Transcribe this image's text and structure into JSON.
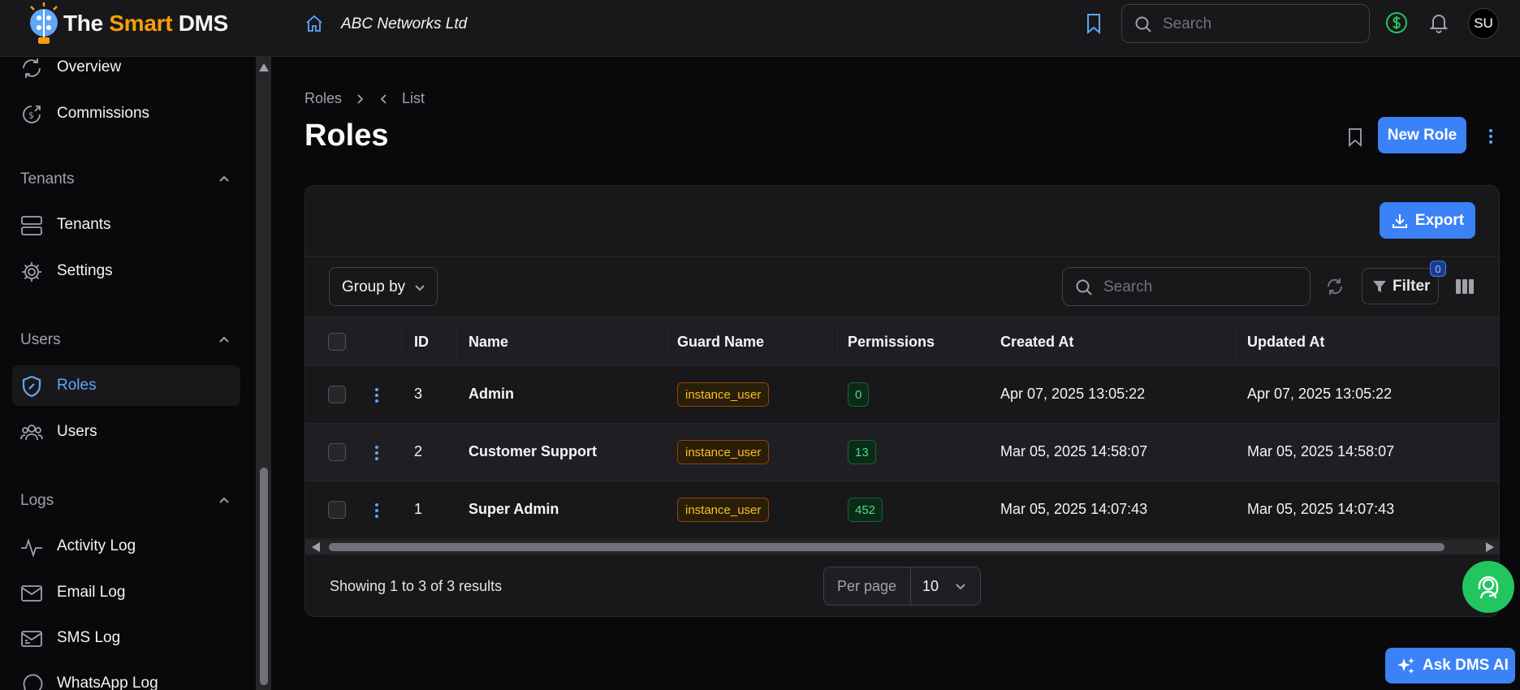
{
  "header": {
    "brand_prefix": "The ",
    "brand_accent": "Smart",
    "brand_suffix": " DMS",
    "tenant_name": "ABC Networks Ltd",
    "search_placeholder": "Search",
    "avatar_initials": "SU"
  },
  "sidebar": {
    "items": [
      {
        "label": "Overview"
      },
      {
        "label": "Commissions"
      },
      {
        "label": "Tenants"
      },
      {
        "label": "Settings"
      },
      {
        "label": "Roles"
      },
      {
        "label": "Users"
      },
      {
        "label": "Activity Log"
      },
      {
        "label": "Email Log"
      },
      {
        "label": "SMS Log"
      },
      {
        "label": "WhatsApp Log"
      }
    ],
    "groups": [
      {
        "label": "Tenants"
      },
      {
        "label": "Users"
      },
      {
        "label": "Logs"
      }
    ]
  },
  "page": {
    "breadcrumb": [
      "Roles",
      "List"
    ],
    "title": "Roles",
    "new_button": "New Role"
  },
  "table": {
    "export_label": "Export",
    "group_by_label": "Group by",
    "search_placeholder": "Search",
    "filter_label": "Filter",
    "filter_count": "0",
    "columns": [
      "ID",
      "Name",
      "Guard Name",
      "Permissions",
      "Created At",
      "Updated At"
    ],
    "rows": [
      {
        "id": "3",
        "name": "Admin",
        "guard": "instance_user",
        "permissions": "0",
        "created": "Apr 07, 2025 13:05:22",
        "updated": "Apr 07, 2025 13:05:22"
      },
      {
        "id": "2",
        "name": "Customer Support",
        "guard": "instance_user",
        "permissions": "13",
        "created": "Mar 05, 2025 14:58:07",
        "updated": "Mar 05, 2025 14:58:07"
      },
      {
        "id": "1",
        "name": "Super Admin",
        "guard": "instance_user",
        "permissions": "452",
        "created": "Mar 05, 2025 14:07:43",
        "updated": "Mar 05, 2025 14:07:43"
      }
    ],
    "summary": "Showing 1 to 3 of 3 results",
    "per_page_label": "Per page",
    "per_page_value": "10"
  },
  "ask_ai_label": "Ask DMS AI",
  "colors": {
    "accent": "#3b82f6",
    "brand_accent": "#f59e0b",
    "guard_badge": "#fbbf24",
    "permission_badge": "#4ade80",
    "help_button": "#22c55e"
  }
}
